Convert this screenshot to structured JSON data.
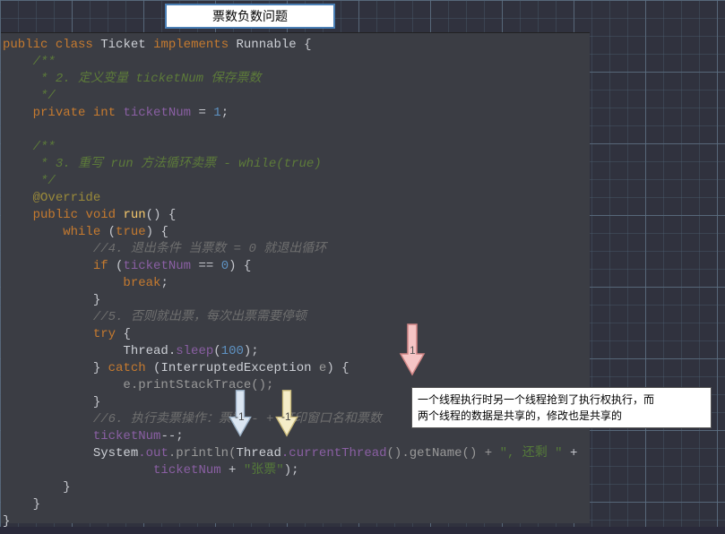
{
  "title": "票数负数问题",
  "code": {
    "l1_public": "public",
    "l1_class": "class",
    "l1_Ticket": "Ticket",
    "l1_implements": "implements",
    "l1_Runnable": "Runnable",
    "l1_brace": " {",
    "doc_open": "/**",
    "doc_l2": " * 2. 定义变量 ticketNum 保存票数",
    "doc_close": " */",
    "l_private": "private",
    "l_int": "int",
    "l_field": "ticketNum",
    "l_eq": " = ",
    "l_one": "1",
    "l_semi": ";",
    "doc2_open": "/**",
    "doc2_l3": " * 3. 重写 run 方法循环卖票 - while(true)",
    "doc2_close": " */",
    "ann": "@Override",
    "run_public": "public",
    "run_void": "void",
    "run_name": "run",
    "run_paren": "()",
    "run_brace": " {",
    "while_kw": "while",
    "while_cond": " (",
    "while_true": "true",
    "while_end": ") {",
    "c4": "//4. 退出条件 当票数 = 0 就退出循环",
    "if_kw": "if",
    "if_open": " (",
    "if_field": "ticketNum",
    "if_eq": " == ",
    "if_zero": "0",
    "if_close": ") {",
    "break_kw": "break",
    "break_semi": ";",
    "brace_close1": "}",
    "c5": "//5. 否则就出票，每次出票需要停顿",
    "try_kw": "try",
    "try_brace": " {",
    "thread_cls": "Thread",
    "sleep_dot": ".",
    "sleep_name": "sleep",
    "sleep_open": "(",
    "sleep_arg": "100",
    "sleep_close": ");",
    "catch_brace": "} ",
    "catch_kw": "catch",
    "catch_open": " (",
    "exc_type": "InterruptedException",
    "exc_var": " e",
    "catch_close": ") {",
    "eprint": "e.printStackTrace();",
    "brace_close2": "}",
    "c6": "//6. 执行卖票操作：票数-- + 打印窗口名和票数",
    "dec_field": "ticketNum",
    "dec_op": "--;",
    "sys": "System",
    "out": ".out",
    "println": ".println(",
    "thread2": "Thread",
    "curthr": ".currentThread",
    "getname": "().getName() + ",
    "str_comma": "\", 还剩 \"",
    "plus": " +",
    "ticket2": "ticketNum",
    "plus2": " + ",
    "str_zhang": "\"张票\"",
    "print_close": ");",
    "close_a": "}",
    "close_b": "}",
    "close_c": "}"
  },
  "arrows": {
    "a1": {
      "label": "1"
    },
    "a2": {
      "label": "-1"
    },
    "a3": {
      "label": "-1"
    }
  },
  "note": {
    "line1": "一个线程执行时另一个线程抢到了执行权执行，而",
    "line2": "两个线程的数据是共享的，修改也是共享的"
  }
}
